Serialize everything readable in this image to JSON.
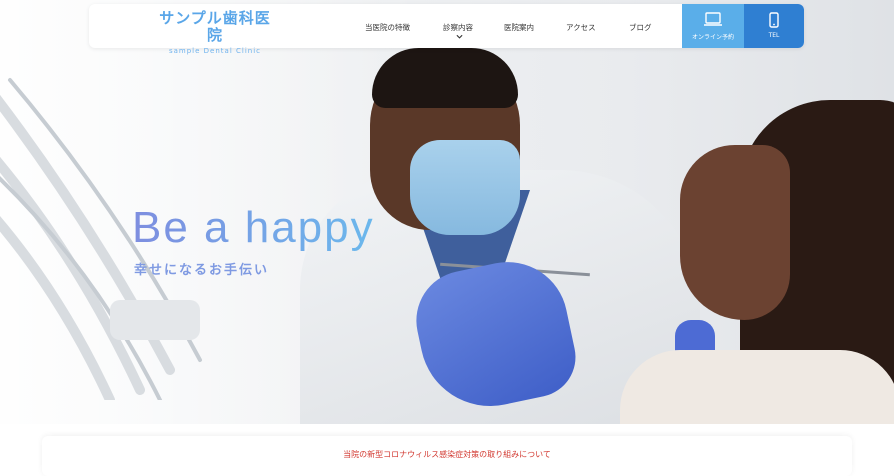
{
  "header": {
    "logo": {
      "title": "サンプル歯科医院",
      "subtitle": "sample Dental Clinic"
    },
    "nav": [
      {
        "label": "当医院の特徴"
      },
      {
        "label": "診察内容",
        "has_dropdown": true
      },
      {
        "label": "医院案内"
      },
      {
        "label": "アクセス"
      },
      {
        "label": "ブログ"
      }
    ],
    "buttons": {
      "online": {
        "label": "オンライン予約",
        "icon": "laptop-icon"
      },
      "tel": {
        "label": "TEL",
        "icon": "smartphone-icon"
      }
    }
  },
  "hero": {
    "tagline": "Be a happy",
    "subtagline": "幸せになるお手伝い"
  },
  "notice": {
    "text": "当院の新型コロナウィルス感染症対策の取り組みについて"
  },
  "colors": {
    "brand_light": "#5aaee9",
    "brand_dark": "#2f7fd2",
    "tagline_gradient_start": "#7e8ee0",
    "tagline_gradient_end": "#6bb8ec",
    "notice_text": "#d2372f"
  }
}
